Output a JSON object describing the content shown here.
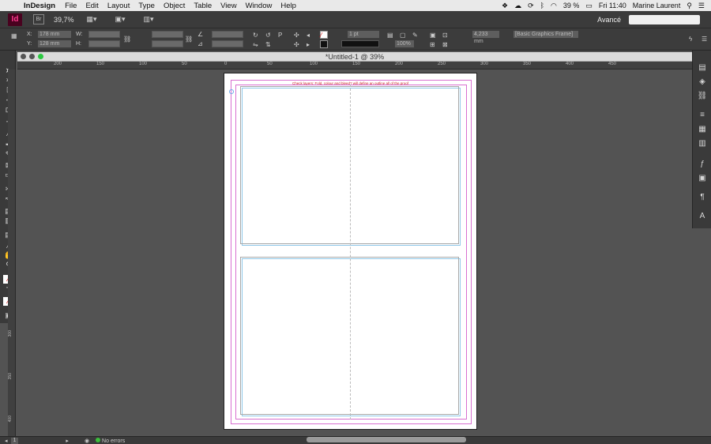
{
  "menubar": {
    "app_name": "InDesign",
    "items": [
      "File",
      "Edit",
      "Layout",
      "Type",
      "Object",
      "Table",
      "View",
      "Window",
      "Help"
    ],
    "battery": "39 %",
    "time": "Fri 11:40",
    "user": "Marine Laurent"
  },
  "appbar": {
    "logo": "Id",
    "bridge": "Br",
    "zoom": "39,7%",
    "workspace": "Avancé"
  },
  "control": {
    "x_label": "X:",
    "y_label": "Y:",
    "w_label": "W:",
    "h_label": "H:",
    "x_value": "178 mm",
    "y_value": "128 mm",
    "stroke_weight": "1 pt",
    "zoom_percent": "100%",
    "dimension": "4,233 mm",
    "style": "[Basic Graphics Frame]"
  },
  "document": {
    "title": "*Untitled-1 @ 39%",
    "slug_text": "Check layers: Fold, colour and bleed? will define an outline all of the proof"
  },
  "ruler": {
    "labels": [
      "200",
      "150",
      "100",
      "50",
      "0",
      "50",
      "100",
      "150",
      "200",
      "250",
      "300",
      "350",
      "400",
      "450"
    ]
  },
  "vruler": {
    "labels": [
      "300",
      "350",
      "400"
    ]
  },
  "status": {
    "page": "1",
    "errors": "No errors"
  }
}
